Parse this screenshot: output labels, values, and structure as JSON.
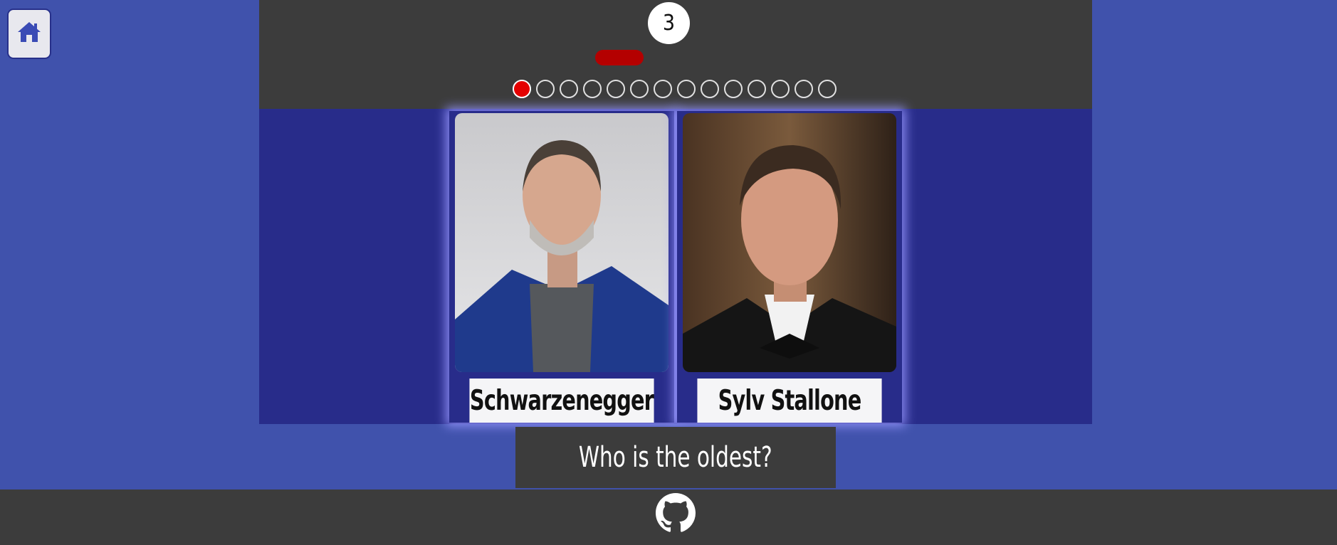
{
  "home": {
    "icon": "home-icon"
  },
  "game": {
    "timer": "3",
    "progress_fraction": 0.05,
    "question_dots": {
      "total": 14,
      "current": 1
    }
  },
  "cards": [
    {
      "name": "Schwarzenegger"
    },
    {
      "name": "Sylv Stallone"
    }
  ],
  "question": "Who is the oldest?",
  "footer": {
    "icon": "github-icon"
  },
  "colors": {
    "background": "#4052ac",
    "stage": "#282c8a",
    "panel": "#3c3c3c",
    "accent_red": "#e40000"
  }
}
